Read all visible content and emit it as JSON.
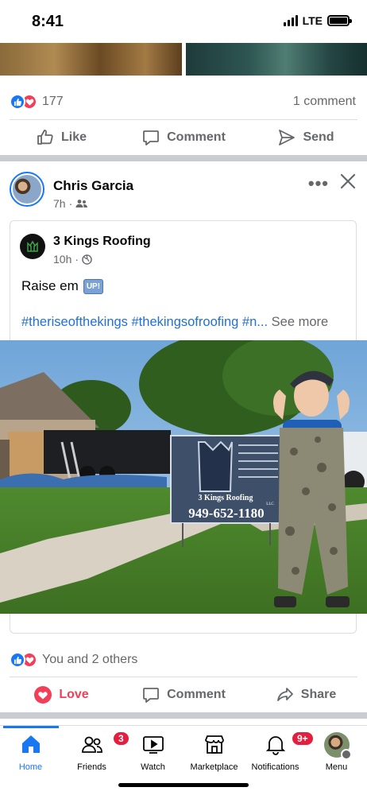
{
  "status_bar": {
    "time": "8:41",
    "network": "LTE"
  },
  "prev_post": {
    "reaction_count": "177",
    "comment_count": "1 comment",
    "actions": {
      "like": "Like",
      "comment": "Comment",
      "send": "Send"
    }
  },
  "post": {
    "author": "Chris Garcia",
    "time": "7h",
    "shared": {
      "page_name": "3 Kings Roofing",
      "time": "10h",
      "text": "Raise em",
      "emoji_badge": "UP!",
      "hashtags": "#theriseofthekings #thekingsofroofing #n...",
      "see_more": "See more"
    },
    "photo_sign": {
      "company": "3 Kings Roofing",
      "suffix": "LLC",
      "phone": "949-652-1180"
    },
    "reactions_text": "You and 2 others",
    "actions": {
      "love": "Love",
      "comment": "Comment",
      "share": "Share"
    }
  },
  "nav": {
    "items": [
      {
        "label": "Home"
      },
      {
        "label": "Friends",
        "badge": "3"
      },
      {
        "label": "Watch"
      },
      {
        "label": "Marketplace"
      },
      {
        "label": "Notifications",
        "badge": "9+"
      },
      {
        "label": "Menu"
      }
    ]
  },
  "colors": {
    "accent": "#1877f2",
    "love": "#f33e58",
    "secondary_text": "#65676b",
    "badge": "#e41e3f"
  }
}
